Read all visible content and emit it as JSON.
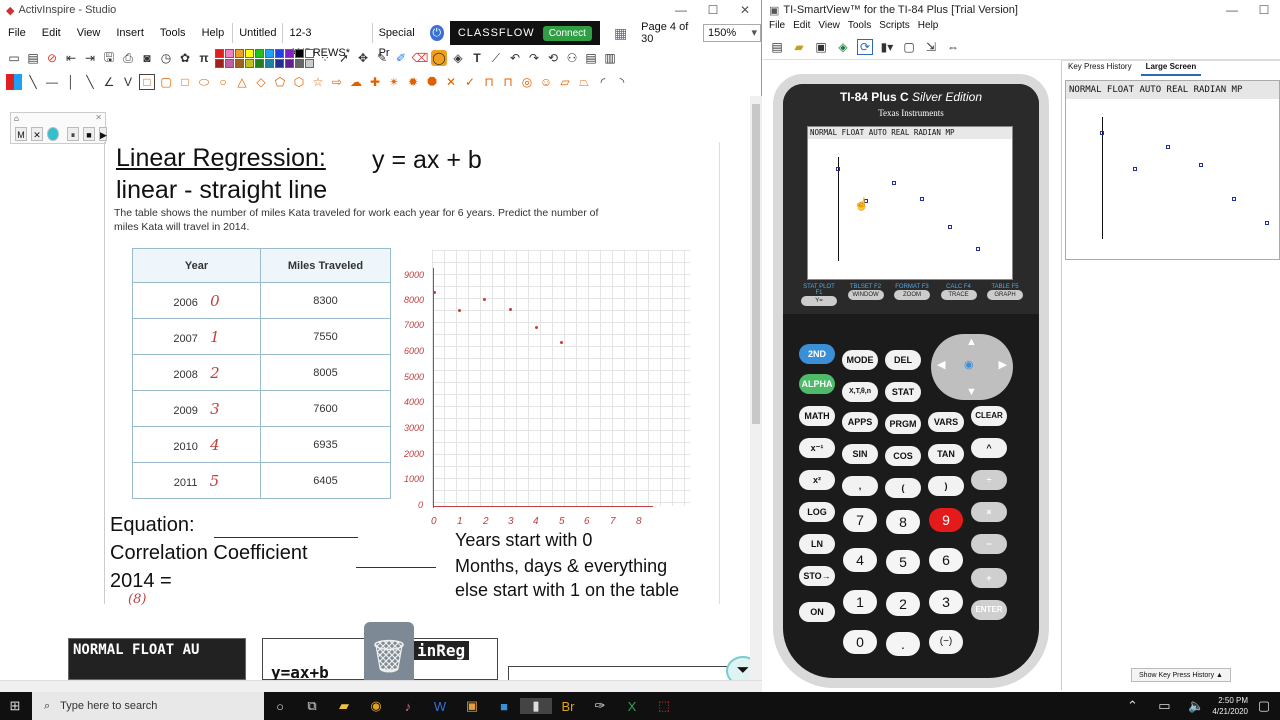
{
  "left_app": {
    "title": "ActivInspire - Studio",
    "menu": [
      "File",
      "Edit",
      "View",
      "Insert",
      "Tools",
      "Help"
    ],
    "doc_tabs": [
      "Untitled",
      "12-3 ANDREWS*",
      "Special Pr"
    ],
    "classflow": {
      "label": "CLASSFLOW",
      "connect": "Connect"
    },
    "page_indicator": "Page 4 of 30",
    "zoom": "150%"
  },
  "flipchart_controls": {
    "labels": [
      "M",
      "✕",
      "⏸",
      "■",
      "▶"
    ]
  },
  "worksheet": {
    "title_part1": "Linear Regression:",
    "title_part2": "y = ax + b",
    "subtitle": "linear - straight line",
    "problem": "The table shows the number of miles Kata traveled for work each year for 6 years. Predict the number of miles Kata will travel in 2014.",
    "table": {
      "headers": [
        "Year",
        "Miles Traveled"
      ],
      "rows": [
        {
          "year": "2006",
          "hw": "0",
          "miles": "8300"
        },
        {
          "year": "2007",
          "hw": "1",
          "miles": "7550"
        },
        {
          "year": "2008",
          "hw": "2",
          "miles": "8005"
        },
        {
          "year": "2009",
          "hw": "3",
          "miles": "7600"
        },
        {
          "year": "2010",
          "hw": "4",
          "miles": "6935"
        },
        {
          "year": "2011",
          "hw": "5",
          "miles": "6405"
        }
      ]
    },
    "y_axis_labels": [
      "9000",
      "8000",
      "7000",
      "6000",
      "5000",
      "4000",
      "3000",
      "2000",
      "1000",
      "0"
    ],
    "x_axis_labels": [
      "0",
      "1",
      "2",
      "3",
      "4",
      "5",
      "6",
      "7",
      "8"
    ],
    "equation_label": "Equation:",
    "correlation_label": "Correlation Coefficient",
    "year_2014_label": "2014 =",
    "hw_8": "(8)",
    "note_line1": "Years start with 0",
    "note_line2": "Months, days & everything",
    "note_line3": "else start with 1 on the table",
    "calc_strip_text": "NORMAL FLOAT AU",
    "calc_strip2_text": "y=ax+b",
    "calc_strip3_text": "inReg"
  },
  "right_app": {
    "title": "TI-SmartView™ for the TI-84 Plus [Trial Version]",
    "menu": [
      "File",
      "Edit",
      "View",
      "Tools",
      "Scripts",
      "Help"
    ],
    "calc_model": "TI-84 Plus C",
    "calc_edition": "Silver Edition",
    "calc_maker": "Texas Instruments",
    "status_bar": "NORMAL FLOAT AUTO REAL RADIAN MP",
    "function_keys": [
      {
        "top": "STAT PLOT F1",
        "label": "Y="
      },
      {
        "top": "TBLSET F2",
        "label": "WINDOW"
      },
      {
        "top": "FORMAT F3",
        "label": "ZOOM"
      },
      {
        "top": "CALC F4",
        "label": "TRACE"
      },
      {
        "top": "TABLE F5",
        "label": "GRAPH"
      }
    ],
    "keys": {
      "second": "2ND",
      "mode": "MODE",
      "del": "DEL",
      "alpha": "ALPHA",
      "xton": "X,T,θ,n",
      "stat": "STAT",
      "math": "MATH",
      "apps": "APPS",
      "prgm": "PRGM",
      "vars": "VARS",
      "clear": "CLEAR",
      "inv": "x⁻¹",
      "sin": "SIN",
      "cos": "COS",
      "tan": "TAN",
      "pow": "^",
      "sq": "x²",
      "comma": ",",
      "lpar": "(",
      "rpar": ")",
      "div": "÷",
      "log": "LOG",
      "n7": "7",
      "n8": "8",
      "n9": "9",
      "mul": "×",
      "ln": "LN",
      "n4": "4",
      "n5": "5",
      "n6": "6",
      "sub": "−",
      "sto": "STO→",
      "n1": "1",
      "n2": "2",
      "n3": "3",
      "add": "+",
      "on": "ON",
      "n0": "0",
      "dot": ".",
      "neg": "(−)",
      "enter": "ENTER"
    },
    "tabs": [
      "Key Press History",
      "Large Screen"
    ],
    "show_history": "Show Key Press History ▲"
  },
  "taskbar": {
    "search_placeholder": "Type here to search",
    "time": "2:50 PM",
    "date": "4/21/2020"
  }
}
